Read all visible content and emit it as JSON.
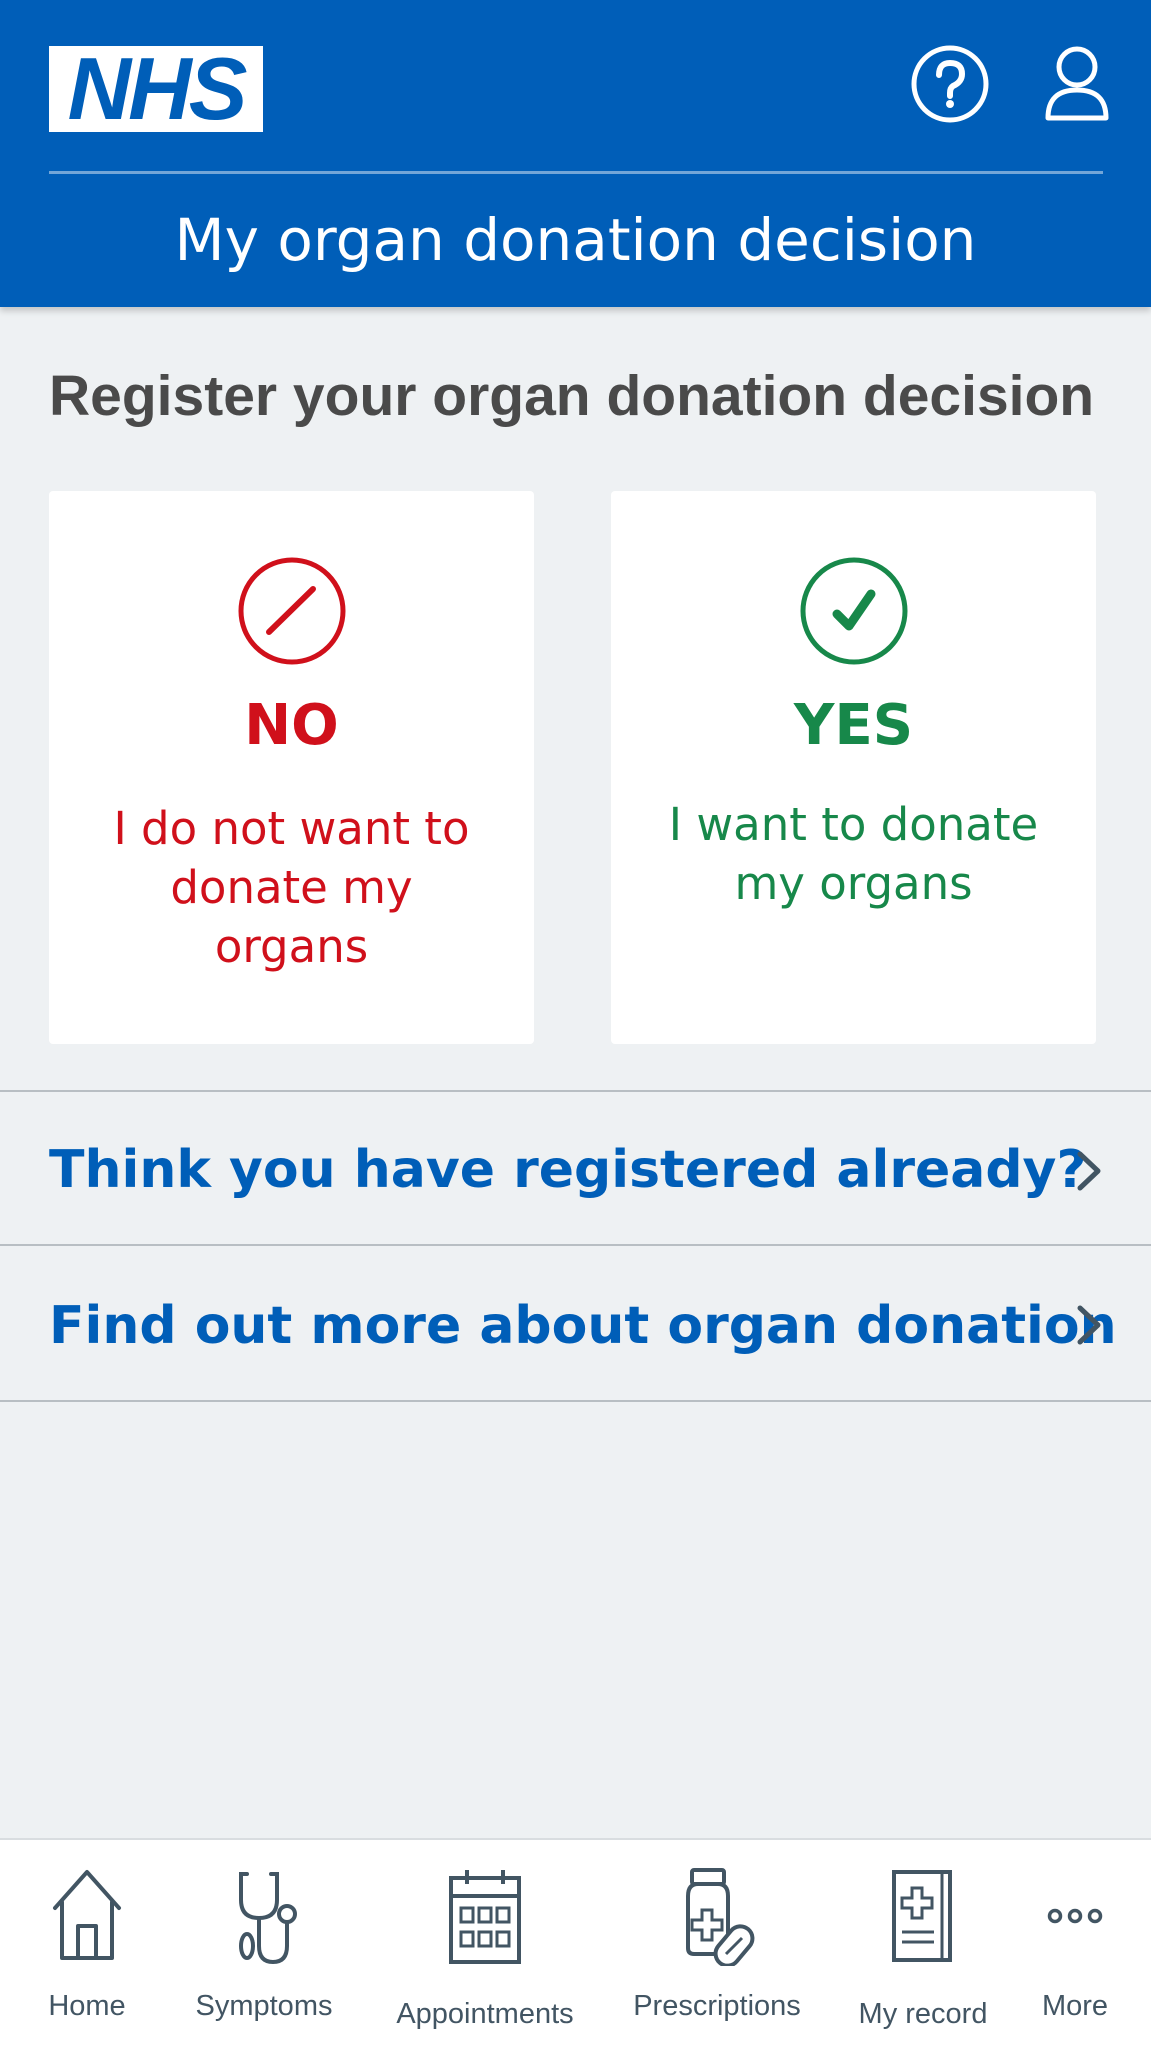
{
  "header": {
    "logo_text": "NHS",
    "title": "My organ donation decision",
    "help_icon": "help-circle-icon",
    "profile_icon": "user-profile-icon",
    "background_color": "#005eb8"
  },
  "main": {
    "heading": "Register your organ donation decision",
    "cards": {
      "no": {
        "icon": "no-entry-circle-icon",
        "title": "NO",
        "description": "I do not want to donate my organs",
        "color": "#d0101b"
      },
      "yes": {
        "icon": "check-circle-icon",
        "title": "YES",
        "description": "I want to donate my organs",
        "color": "#17884a"
      }
    },
    "links": [
      {
        "label": "Think you have registered already?",
        "icon": "chevron-right-icon"
      },
      {
        "label": "Find out more about organ donation",
        "icon": "chevron-right-icon"
      }
    ]
  },
  "bottom_nav": {
    "items": [
      {
        "label": "Home",
        "icon": "home-icon"
      },
      {
        "label": "Symptoms",
        "icon": "stethoscope-icon"
      },
      {
        "label": "Appointments",
        "icon": "calendar-icon"
      },
      {
        "label": "Prescriptions",
        "icon": "medicine-bottle-icon"
      },
      {
        "label": "My record",
        "icon": "medical-record-icon"
      },
      {
        "label": "More",
        "icon": "more-dots-icon"
      }
    ]
  }
}
